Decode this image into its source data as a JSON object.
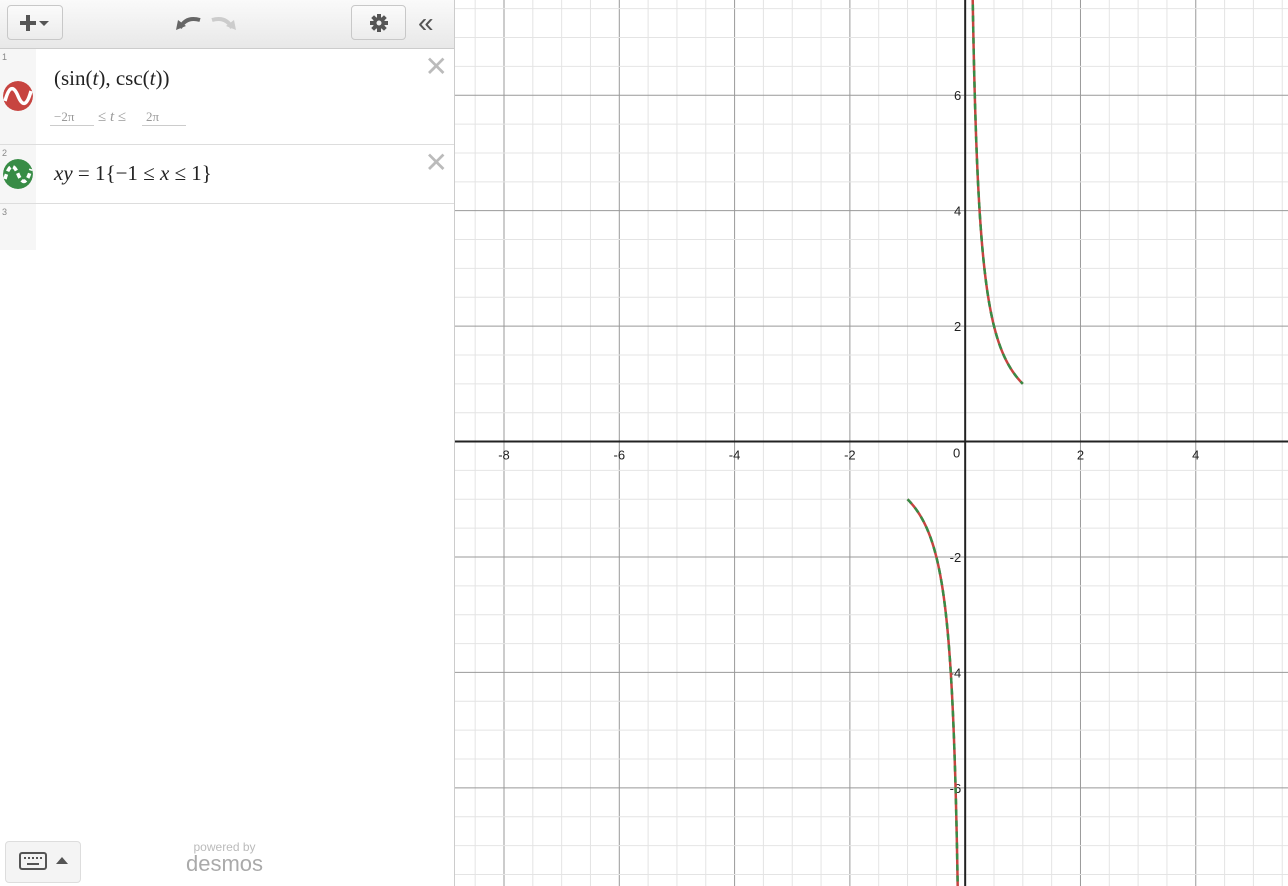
{
  "toolbar": {
    "add_icon": "plus-dropdown-icon",
    "undo_icon": "undo-icon",
    "redo_icon": "redo-icon",
    "settings_icon": "gear-icon",
    "collapse_icon": "double-chevron-left-icon",
    "collapse_glyph": "«"
  },
  "expressions": [
    {
      "number": "1",
      "color": "#c74440",
      "latex_parts": [
        "(",
        "sin(",
        "t",
        "), csc(",
        "t",
        ")",
        ")"
      ],
      "display": "(sin(t), csc(t))",
      "t_min": "−2π",
      "t_max": "2π",
      "t_label_left": "≤",
      "t_var": "t",
      "t_label_right": "≤"
    },
    {
      "number": "2",
      "color": "#388c46",
      "display_xy": "xy",
      "display_rest": " = 1{−1 ≤ ",
      "display_x": "x",
      "display_end": " ≤ 1}"
    },
    {
      "number": "3"
    }
  ],
  "close_glyph": "✕",
  "footer": {
    "powered_by": "powered by",
    "brand": "desmos",
    "keyboard_icon": "keyboard-icon"
  },
  "graph": {
    "x_range": [
      -8.85,
      5.6
    ],
    "y_range": [
      -7.7,
      7.65
    ],
    "x_tick_labels": [
      "-8",
      "-6",
      "-4",
      "-2",
      "2",
      "4"
    ],
    "y_tick_labels": [
      "6",
      "4",
      "2",
      "-2",
      "-4",
      "-6"
    ],
    "origin_label": "0",
    "curve_colors": [
      "#c74440",
      "#388c46"
    ]
  }
}
